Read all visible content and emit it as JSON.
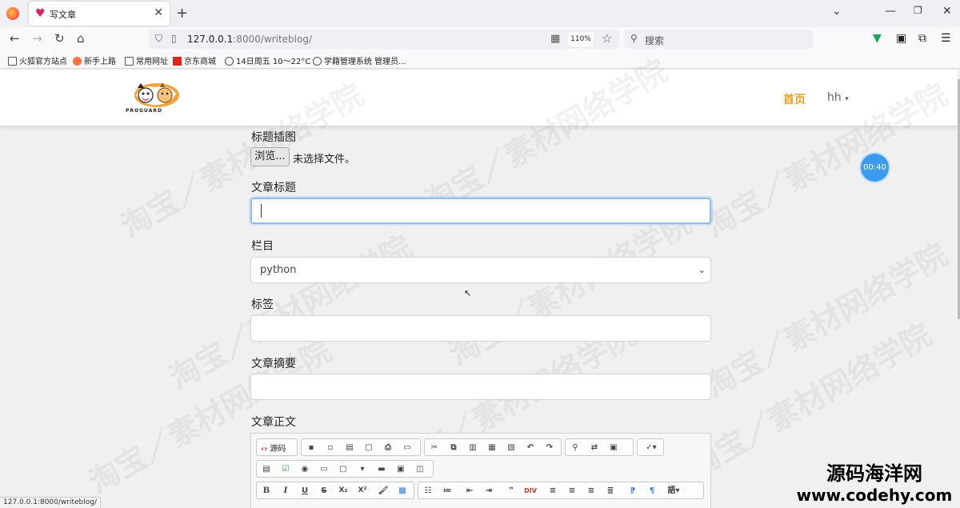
{
  "browser": {
    "tab": {
      "title": "写文章",
      "icon": "heart-icon"
    },
    "url": {
      "host": "127.0.0.1",
      "path": ":8000/writeblog/"
    },
    "zoom": "110%",
    "search_placeholder": "搜索",
    "bookmarks": [
      "火狐官方站点",
      "新手上路",
      "常用网址",
      "京东商城",
      "14日周五  10～22°C",
      "学籍管理系统 管理员..."
    ],
    "status_url": "127.0.0.1:8000/writeblog/"
  },
  "site": {
    "logo_text": "PROGUARD",
    "nav": {
      "home": "首页",
      "user": "hh"
    }
  },
  "form": {
    "cover_label": "标题插图",
    "browse_button": "浏览...",
    "file_status": "未选择文件。",
    "title_label": "文章标题",
    "title_value": "",
    "category_label": "栏目",
    "category_selected": "python",
    "tags_label": "标签",
    "tags_value": "",
    "summary_label": "文章摘要",
    "summary_value": "",
    "body_label": "文章正文"
  },
  "editor": {
    "source_label": "源码",
    "toolbar_row3": [
      "B",
      "I",
      "U",
      "S",
      "X₂",
      "X²"
    ]
  },
  "timer": "00:40",
  "watermark": "淘宝／素材网络学院",
  "corner_watermark": {
    "cn": "源码海洋网",
    "en": "www.codehy.com"
  },
  "colors": {
    "accent": "#f0a020",
    "focus": "#8dbdf5",
    "timer": "#3d9bef"
  }
}
